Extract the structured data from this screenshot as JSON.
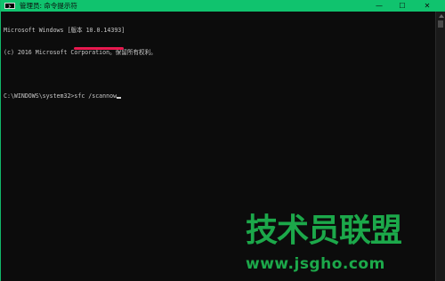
{
  "window": {
    "title": "管理员: 命令提示符",
    "controls": {
      "minimize": "—",
      "maximize": "☐",
      "close": "✕"
    }
  },
  "console": {
    "lines": [
      "Microsoft Windows [版本 10.0.14393]",
      "(c) 2016 Microsoft Corporation。保留所有权利。",
      "",
      "C:\\WINDOWS\\system32>sfc /scannow"
    ]
  },
  "watermark": {
    "text": "技术员联盟",
    "url": "www.jsgho.com"
  },
  "colors": {
    "titlebar": "#10c36e",
    "console_bg": "#0c0c0c",
    "console_text": "#c7c7c7",
    "annotation_underline": "#e8194f",
    "watermark": "#1ca84a"
  },
  "icons": {
    "app": "cmd-icon",
    "minimize": "minimize-icon",
    "maximize": "maximize-icon",
    "close": "close-icon"
  }
}
